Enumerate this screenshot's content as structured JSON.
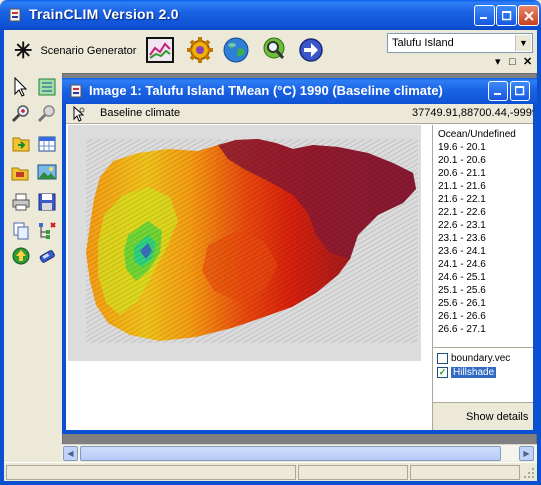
{
  "app": {
    "title": "TrainCLIM Version 2.0"
  },
  "toolbar": {
    "scenario_label": "Scenario Generator",
    "scenario_accesskey_char": "G",
    "icons": [
      "chart-icon",
      "gear-icon",
      "globe-icon",
      "magnifier-icon",
      "arrow-circle-icon"
    ],
    "location_select": {
      "value": "Talufu Island",
      "arrow": "▼"
    },
    "mdi_controls": {
      "restore": "▾",
      "maximize": "□",
      "close": "✕"
    }
  },
  "toolbox": {
    "tools": [
      "pointer-icon",
      "list-icon",
      "zoom-in-icon",
      "zoom-out-icon",
      "import-icon",
      "grid-icon",
      "open-folder-icon",
      "image-icon",
      "print-icon",
      "save-icon",
      "copy-icon",
      "layers-icon",
      "upload-icon",
      "phone-icon"
    ]
  },
  "image_window": {
    "title": "Image 1: Talufu Island TMean (°C) 1990 (Baseline climate)",
    "info_left": "Baseline climate",
    "info_right": "37749.91,88700.44,-9999"
  },
  "legend": {
    "colors": [
      "#3a6dba",
      "#4aa3c9",
      "#2fd17d",
      "#5ed63a",
      "#9fdc2a",
      "#d6e01f",
      "#f0c21b",
      "#f59a13",
      "#ee7011",
      "#e84a0e",
      "#d9200c",
      "#c41a0d",
      "#a81c1a",
      "#8e1a2e",
      "#7a1a3a"
    ],
    "entries": [
      "Ocean/Undefined",
      "19.6 - 20.1",
      "20.1 - 20.6",
      "20.6 - 21.1",
      "21.1 - 21.6",
      "21.6 - 22.1",
      "22.1 - 22.6",
      "22.6 - 23.1",
      "23.1 - 23.6",
      "23.6 - 24.1",
      "24.1 - 24.6",
      "24.6 - 25.1",
      "25.1 - 25.6",
      "25.6 - 26.1",
      "26.1 - 26.6",
      "26.6 - 27.1"
    ]
  },
  "layers": [
    {
      "name": "boundary.vec",
      "checked": false,
      "check_glyph": ""
    },
    {
      "name": "Hillshade",
      "checked": true,
      "check_glyph": "✓"
    }
  ],
  "details_button": "Show details",
  "scroll": {
    "left": "◀",
    "right": "▶"
  }
}
